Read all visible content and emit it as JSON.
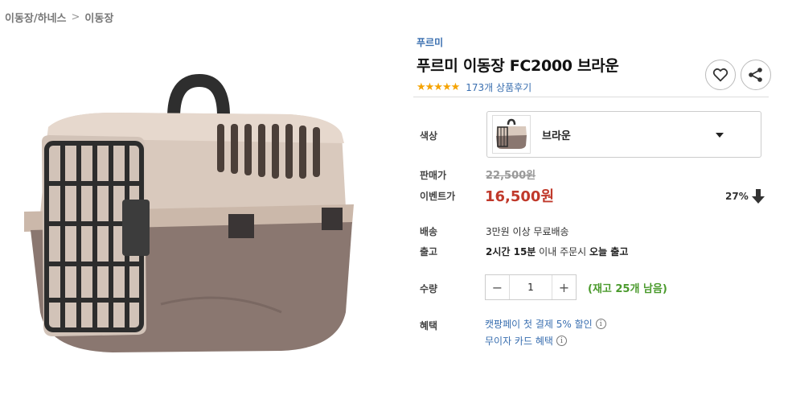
{
  "breadcrumb": {
    "parent": "이동장/하네스",
    "separator": ">",
    "current": "이동장"
  },
  "product": {
    "brand": "푸르미",
    "title": "푸르미 이동장 FC2000 브라운",
    "stars": "★★★★★",
    "review_count_text": "173개 상품후기"
  },
  "icons": {
    "wishlist": "heart-icon",
    "share": "share-icon"
  },
  "options": {
    "color_label": "색상",
    "selected_color": "브라운"
  },
  "price": {
    "sale_label": "판매가",
    "original_price": "22,500원",
    "event_label": "이벤트가",
    "event_price": "16,500원",
    "discount": "27%"
  },
  "shipping": {
    "delivery_label": "배송",
    "delivery_text": "3만원 이상 무료배송",
    "release_label": "출고",
    "release_time_bold": "2시간 15분",
    "release_mid": " 이내 주문시 ",
    "release_today_bold": "오늘 출고"
  },
  "quantity": {
    "label": "수량",
    "minus": "−",
    "value": "1",
    "plus": "+",
    "stock_text": "(재고 25개 남음)"
  },
  "benefits": {
    "label": "혜택",
    "items": [
      "캣팡페이 첫 결제 5% 할인",
      "무이자 카드 혜택"
    ]
  },
  "colors": {
    "accent_blue": "#3a6fb0",
    "price_red": "#c0392b",
    "stock_green": "#4a9a2c",
    "star": "#f5a300"
  }
}
